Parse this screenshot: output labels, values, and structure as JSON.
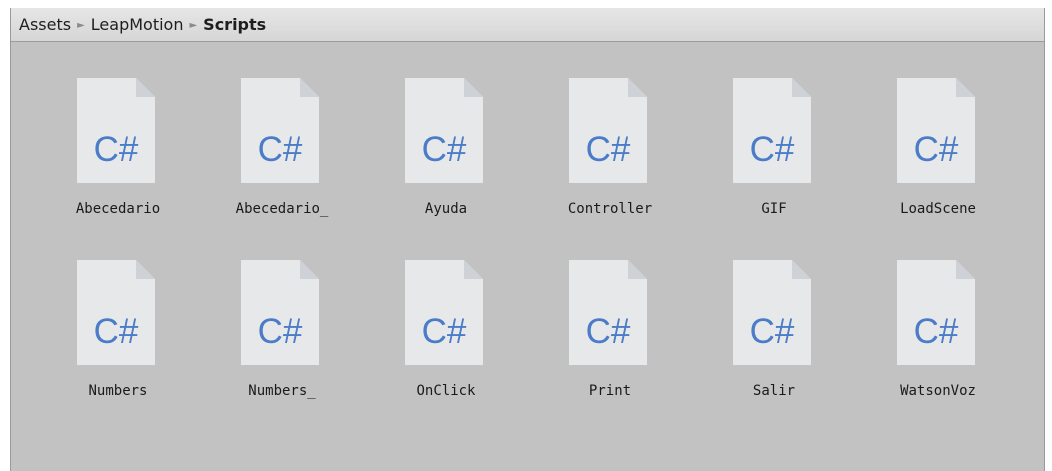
{
  "breadcrumb": {
    "items": [
      "Assets",
      "LeapMotion",
      "Scripts"
    ],
    "separator": "►"
  },
  "colors": {
    "panel_bg": "#c2c2c2",
    "doc_fill": "#e7e8ea",
    "doc_fold": "#ced1d6",
    "cs_text": "#4a7cc8"
  },
  "assets": [
    {
      "name": "Abecedario",
      "icon": "csharp-script-icon",
      "icon_text": "C#"
    },
    {
      "name": "Abecedario_",
      "icon": "csharp-script-icon",
      "icon_text": "C#"
    },
    {
      "name": "Ayuda",
      "icon": "csharp-script-icon",
      "icon_text": "C#"
    },
    {
      "name": "Controller",
      "icon": "csharp-script-icon",
      "icon_text": "C#"
    },
    {
      "name": "GIF",
      "icon": "csharp-script-icon",
      "icon_text": "C#"
    },
    {
      "name": "LoadScene",
      "icon": "csharp-script-icon",
      "icon_text": "C#"
    },
    {
      "name": "Numbers",
      "icon": "csharp-script-icon",
      "icon_text": "C#"
    },
    {
      "name": "Numbers_",
      "icon": "csharp-script-icon",
      "icon_text": "C#"
    },
    {
      "name": "OnClick",
      "icon": "csharp-script-icon",
      "icon_text": "C#"
    },
    {
      "name": "Print",
      "icon": "csharp-script-icon",
      "icon_text": "C#"
    },
    {
      "name": "Salir",
      "icon": "csharp-script-icon",
      "icon_text": "C#"
    },
    {
      "name": "WatsonVoz",
      "icon": "csharp-script-icon",
      "icon_text": "C#"
    }
  ]
}
